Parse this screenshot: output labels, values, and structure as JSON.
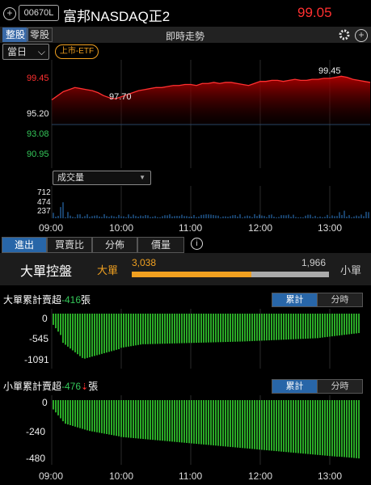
{
  "header": {
    "code": "00670L",
    "name": "富邦NASDAQ正2",
    "price": "99.05"
  },
  "toolbar": {
    "tab_whole": "整股",
    "tab_odd": "零股",
    "title": "即時走勢",
    "period": "當日",
    "etf_badge": "上市-ETF"
  },
  "price_chart": {
    "type": "area",
    "y_ticks": [
      "99.45",
      "95.20",
      "93.08",
      "90.95"
    ],
    "ylim": [
      90.95,
      101.5
    ],
    "reference": 95.2,
    "annotations": [
      {
        "text": "97.70",
        "value": 97.7
      },
      {
        "text": "99.45",
        "value": 99.45
      }
    ],
    "values": [
      97.6,
      98.0,
      98.4,
      98.6,
      98.8,
      98.7,
      98.6,
      98.5,
      98.3,
      98.0,
      97.8,
      97.7,
      97.9,
      98.1,
      98.3,
      98.5,
      98.6,
      98.7,
      98.8,
      98.8,
      98.9,
      99.0,
      99.0,
      99.1,
      99.1,
      99.0,
      99.2,
      99.2,
      99.3,
      99.2,
      99.3,
      99.3,
      99.2,
      99.1,
      99.0,
      99.2,
      99.4,
      99.4,
      99.5,
      99.5,
      99.4,
      99.5,
      99.6,
      99.5,
      99.5,
      99.6,
      99.6,
      99.7,
      99.7,
      99.8,
      99.9,
      99.8,
      99.6,
      99.5,
      99.4,
      99.3
    ]
  },
  "volume": {
    "selector": "成交量",
    "y_ticks": [
      "712",
      "474",
      "237"
    ],
    "max": 712
  },
  "time_axis": [
    "09:00",
    "10:00",
    "11:00",
    "12:00",
    "13:00"
  ],
  "bottom_tabs": [
    "進出",
    "買賣比",
    "分佈",
    "價量"
  ],
  "control": {
    "title": "大單控盤",
    "big_label": "大單",
    "small_label": "小單",
    "big_value": "3,038",
    "small_value": "1,966",
    "big_fraction": 0.607
  },
  "big_order": {
    "label": "大單累計賣超",
    "value": "-416",
    "unit": "張",
    "btn_cum": "累計",
    "btn_time": "分時",
    "y_ticks": [
      "0",
      "-545",
      "-1091"
    ],
    "ylim": [
      -1150,
      0
    ]
  },
  "small_order": {
    "label": "小單累計賣超",
    "value": "-476",
    "unit": "張",
    "btn_cum": "累計",
    "btn_time": "分時",
    "y_ticks": [
      "0",
      "-240",
      "-480"
    ],
    "ylim": [
      -500,
      0
    ]
  },
  "colors": {
    "up": "#ff3030",
    "down": "#34c759",
    "accent": "#f0a020",
    "tab_on": "#2866a8"
  }
}
